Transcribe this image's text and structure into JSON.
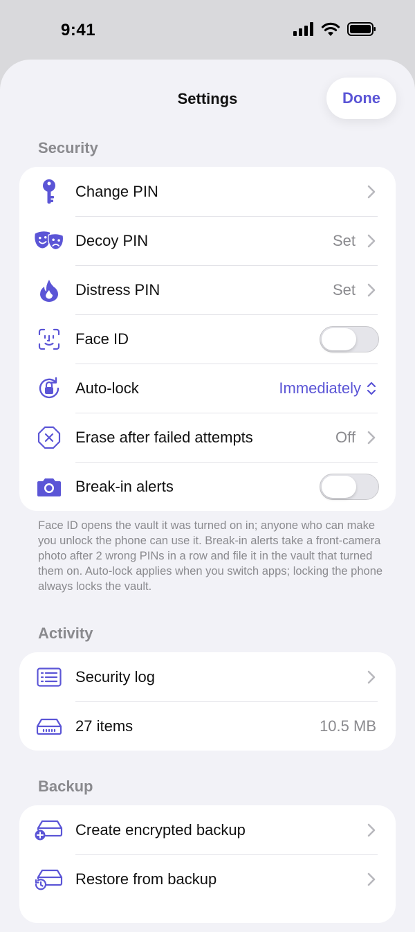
{
  "status_bar": {
    "time": "9:41"
  },
  "nav": {
    "title": "Settings",
    "done_label": "Done"
  },
  "colors": {
    "accent": "#5b55d6",
    "secondary_text": "#8a8a8e",
    "background": "#f2f2f7"
  },
  "sections": {
    "security": {
      "header": "Security",
      "rows": [
        {
          "label": "Change PIN",
          "icon": "key-icon"
        },
        {
          "label": "Decoy PIN",
          "value": "Set",
          "icon": "theater-masks-icon"
        },
        {
          "label": "Distress PIN",
          "value": "Set",
          "icon": "flame-icon"
        },
        {
          "label": "Face ID",
          "toggle": false,
          "icon": "face-id-icon"
        },
        {
          "label": "Auto-lock",
          "value": "Immediately",
          "icon": "lock-rotation-icon"
        },
        {
          "label": "Erase after failed attempts",
          "value": "Off",
          "icon": "x-octagon-icon"
        },
        {
          "label": "Break-in alerts",
          "toggle": false,
          "icon": "camera-icon"
        }
      ],
      "footer": "Face ID opens the vault it was turned on in; anyone who can make you unlock the phone can use it. Break-in alerts take a front-camera photo after 2 wrong PINs in a row and file it in the vault that turned them on. Auto-lock applies when you switch apps; locking the phone always locks the vault."
    },
    "activity": {
      "header": "Activity",
      "rows": [
        {
          "label": "Security log",
          "icon": "list-icon"
        },
        {
          "label": "27 items",
          "value": "10.5 MB",
          "icon": "drive-icon"
        }
      ]
    },
    "backup": {
      "header": "Backup",
      "rows": [
        {
          "label": "Create encrypted backup",
          "icon": "drive-add-icon"
        },
        {
          "label": "Restore from backup",
          "icon": "drive-restore-icon"
        }
      ]
    }
  }
}
